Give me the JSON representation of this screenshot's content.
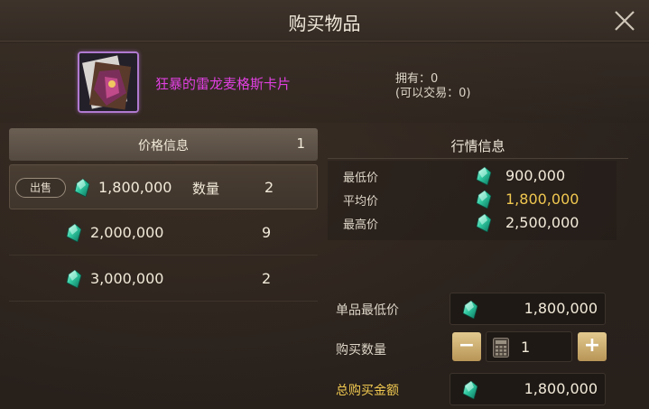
{
  "window": {
    "title": "购买物品"
  },
  "item": {
    "name": "狂暴的雷龙麦格斯卡片",
    "owned_label": "拥有：0",
    "tradable_label": "(可以交易：0)"
  },
  "price_panel": {
    "header_label": "价格信息",
    "header_count": "1",
    "listings": [
      {
        "badge": "出售",
        "price": "1,800,000",
        "qty_label": "数量",
        "qty": "2"
      },
      {
        "price": "2,000,000",
        "qty": "9"
      },
      {
        "price": "3,000,000",
        "qty": "2"
      }
    ]
  },
  "market_panel": {
    "header_label": "行情信息",
    "rows": [
      {
        "label": "最低价",
        "value": "900,000"
      },
      {
        "label": "平均价",
        "value": "1,800,000"
      },
      {
        "label": "最高价",
        "value": "2,500,000"
      }
    ]
  },
  "purchase_form": {
    "min_price_label": "单品最低价",
    "min_price_value": "1,800,000",
    "quantity_label": "购买数量",
    "quantity_value": "1",
    "minus_label": "−",
    "plus_label": "+",
    "total_label": "总购买金额",
    "total_value": "1,800,000"
  },
  "colors": {
    "item_name": "#e040e0",
    "average_price": "#f0c850",
    "total_label": "#f0c850",
    "stepper": "#d4b77a",
    "gem": "#2fc9a0"
  },
  "icons": {
    "close": "close-icon",
    "currency": "gem-icon",
    "keypad": "calculator-icon"
  }
}
